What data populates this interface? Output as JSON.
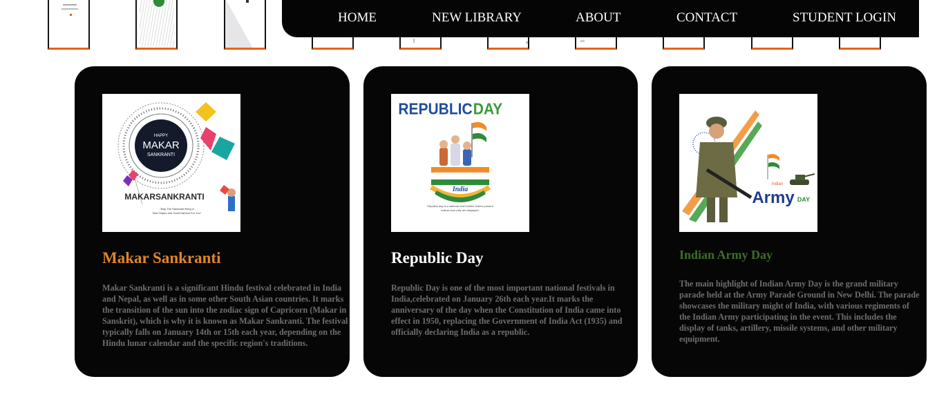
{
  "nav": {
    "items": [
      "HOME",
      "NEW LIBRARY",
      "ABOUT",
      "CONTACT",
      "STUDENT LOGIN"
    ]
  },
  "cards": [
    {
      "title": "Makar Sankranti",
      "title_color": "#e0852a",
      "image": {
        "small_top": "HAPPY",
        "center_line1": "MAKAR",
        "center_line2": "SANKRANTI",
        "bottom": "MAKARSANKRANTI",
        "caption_line1": "\"May The Sankranti Bring in",
        "caption_line2": "New Hopes and Good Harvest For You\""
      },
      "text": "Makar Sankranti is a significant Hindu festival celebrated in India and Nepal, as well as in some other South Asian countries. It marks the transition of the sun into the zodiac sign of Capricorn (Makar in Sanskrit), which is why it is known as Makar Sankranti. The festival typically falls on January 14th or 15th each year, depending on the Hindu lunar calendar and the specific region's traditions."
    },
    {
      "title": "Republic Day",
      "title_color": "#ffffff",
      "image": {
        "heading_blue": "REPUBLIC",
        "heading_green": "DAY",
        "ribbon": "India",
        "caption_line1": "Republic day is a national event where India's present",
        "caption_line2": "culture and unity are displayed."
      },
      "text": "Republic Day is one of the most important national festivals in India,celebrated on January 26th each year.It marks the anniversary of the day when the Constitution of India came into effect in 1950, replacing the Government of India Act (1935) and officially declaring India as a republic."
    },
    {
      "title": "Indian Army Day",
      "title_color": "#3c6e2a",
      "image": {
        "small": "Indian",
        "army": "Army",
        "day": "DAY"
      },
      "text": "The main highlight of Indian Army Day is the grand military parade held at the Army Parade Ground in New Delhi. The parade showcases the military might of India, with various regiments of the Indian Army participating in the event. This includes the display of tanks, artillery, missile systems, and other military equipment."
    }
  ]
}
